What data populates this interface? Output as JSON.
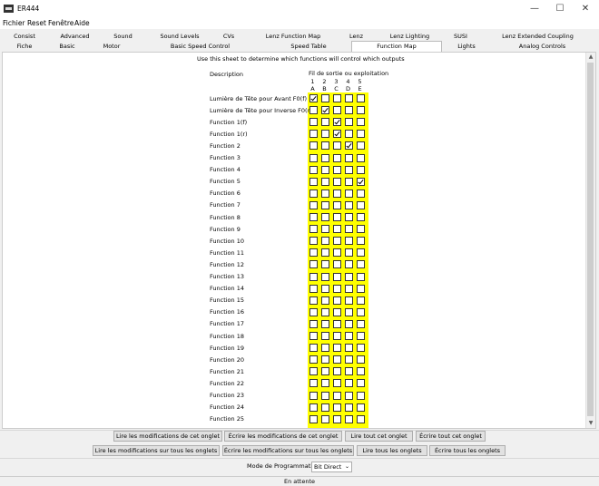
{
  "window": {
    "title": "ER444",
    "minimize_icon": "—",
    "maximize_icon": "☐",
    "close_icon": "✕"
  },
  "menu": [
    "Fichier",
    "Reset",
    "Fenêtre",
    "Aide"
  ],
  "tabs_row1": [
    "Consist",
    "Advanced",
    "Sound",
    "Sound Levels",
    "CVs",
    "Lenz Function Map",
    "Lenz",
    "Lenz Lighting",
    "SUSI",
    "Lenz Extended Coupling"
  ],
  "tabs_row2": [
    "Fiche",
    "Basic",
    "Motor",
    "Basic Speed Control",
    "Speed Table",
    "Function Map",
    "Lights",
    "Analog Controls"
  ],
  "selected_tab": "Function Map",
  "function_map": {
    "instruction": "Use this sheet to determine which functions will control which outputs",
    "description_header": "Description",
    "outputs_header": "Fil de sortie ou exploitation",
    "column_numbers": [
      "1",
      "2",
      "3",
      "4",
      "5"
    ],
    "column_letters": [
      "A",
      "B",
      "C",
      "D",
      "E"
    ],
    "rows": [
      {
        "label": "Lumière de Tête pour Avant F0(f)",
        "checks": [
          true,
          false,
          false,
          false,
          false
        ]
      },
      {
        "label": "Lumière de Tête pour Inverse F0(r)",
        "checks": [
          false,
          true,
          false,
          false,
          false
        ]
      },
      {
        "label": "Function 1(f)",
        "checks": [
          false,
          false,
          true,
          false,
          false
        ]
      },
      {
        "label": "Function 1(r)",
        "checks": [
          false,
          false,
          true,
          false,
          false
        ]
      },
      {
        "label": "Function 2",
        "checks": [
          false,
          false,
          false,
          true,
          false
        ]
      },
      {
        "label": "Function 3",
        "checks": [
          false,
          false,
          false,
          false,
          false
        ]
      },
      {
        "label": "Function 4",
        "checks": [
          false,
          false,
          false,
          false,
          false
        ]
      },
      {
        "label": "Function 5",
        "checks": [
          false,
          false,
          false,
          false,
          true
        ]
      },
      {
        "label": "Function 6",
        "checks": [
          false,
          false,
          false,
          false,
          false
        ]
      },
      {
        "label": "Function 7",
        "checks": [
          false,
          false,
          false,
          false,
          false
        ]
      },
      {
        "label": "Function 8",
        "checks": [
          false,
          false,
          false,
          false,
          false
        ]
      },
      {
        "label": "Function 9",
        "checks": [
          false,
          false,
          false,
          false,
          false
        ]
      },
      {
        "label": "Function 10",
        "checks": [
          false,
          false,
          false,
          false,
          false
        ]
      },
      {
        "label": "Function 11",
        "checks": [
          false,
          false,
          false,
          false,
          false
        ]
      },
      {
        "label": "Function 12",
        "checks": [
          false,
          false,
          false,
          false,
          false
        ]
      },
      {
        "label": "Function 13",
        "checks": [
          false,
          false,
          false,
          false,
          false
        ]
      },
      {
        "label": "Function 14",
        "checks": [
          false,
          false,
          false,
          false,
          false
        ]
      },
      {
        "label": "Function 15",
        "checks": [
          false,
          false,
          false,
          false,
          false
        ]
      },
      {
        "label": "Function 16",
        "checks": [
          false,
          false,
          false,
          false,
          false
        ]
      },
      {
        "label": "Function 17",
        "checks": [
          false,
          false,
          false,
          false,
          false
        ]
      },
      {
        "label": "Function 18",
        "checks": [
          false,
          false,
          false,
          false,
          false
        ]
      },
      {
        "label": "Function 19",
        "checks": [
          false,
          false,
          false,
          false,
          false
        ]
      },
      {
        "label": "Function 20",
        "checks": [
          false,
          false,
          false,
          false,
          false
        ]
      },
      {
        "label": "Function 21",
        "checks": [
          false,
          false,
          false,
          false,
          false
        ]
      },
      {
        "label": "Function 22",
        "checks": [
          false,
          false,
          false,
          false,
          false
        ]
      },
      {
        "label": "Function 23",
        "checks": [
          false,
          false,
          false,
          false,
          false
        ]
      },
      {
        "label": "Function 24",
        "checks": [
          false,
          false,
          false,
          false,
          false
        ]
      },
      {
        "label": "Function 25",
        "checks": [
          false,
          false,
          false,
          false,
          false
        ]
      }
    ]
  },
  "buttons_row1": [
    "Lire les modifications de cet onglet",
    "Écrire les modifications de cet onglet",
    "Lire tout cet onglet",
    "Écrire tout cet onglet"
  ],
  "buttons_row2": [
    "Lire les modifications sur tous les onglets",
    "Écrire les modifications sur tous les onglets",
    "Lire tous les onglets",
    "Écrire tous les onglets"
  ],
  "programming": {
    "label": "Mode de Programmation",
    "value": "Bit Direct"
  },
  "status": "En attente",
  "colors": {
    "highlight": "#ffff00"
  }
}
